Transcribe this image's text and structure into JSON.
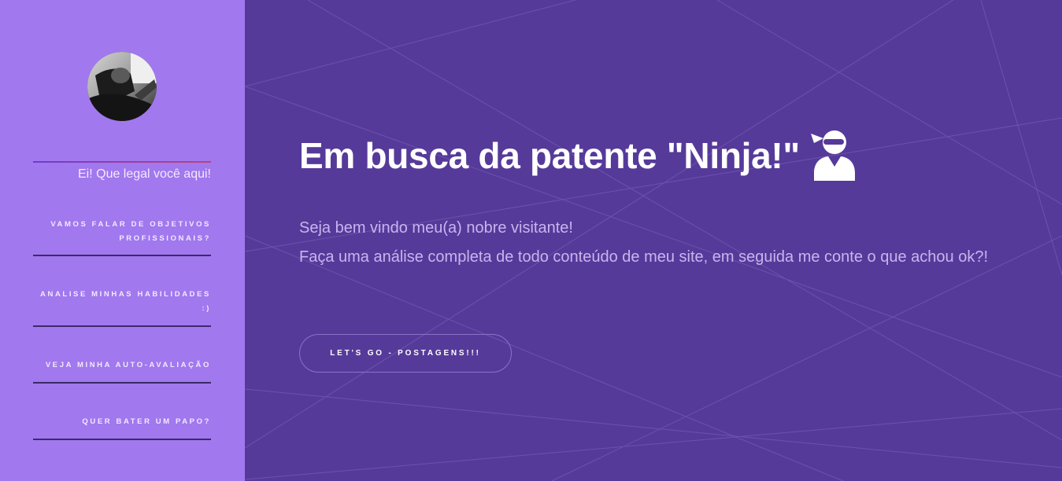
{
  "sidebar": {
    "greeting": "Ei! Que legal você aqui!",
    "nav_items": [
      {
        "label": "VAMOS FALAR DE OBJETIVOS PROFISSIONAIS?"
      },
      {
        "label": "ANALISE MINHAS HABILIDADES :)"
      },
      {
        "label": "VEJA MINHA AUTO-AVALIAÇÃO"
      },
      {
        "label": "QUER BATER UM PAPO?"
      }
    ]
  },
  "hero": {
    "title": "Em busca da patente \"Ninja!\"",
    "title_icon": "ninja-icon",
    "subtitle_line1": "Seja bem vindo meu(a) nobre visitante!",
    "subtitle_line2": "Faça uma análise completa de todo conteúdo de meu site, em seguida me conte o que achou ok?!",
    "cta_label": "LET'S GO - POSTAGENS!!!"
  },
  "colors": {
    "sidebar_bg": "#a178ee",
    "main_bg": "#563a9a",
    "nav_rule": "#3b2a66",
    "title_text": "#ffffff",
    "subtitle_text": "#cbb3ee"
  }
}
